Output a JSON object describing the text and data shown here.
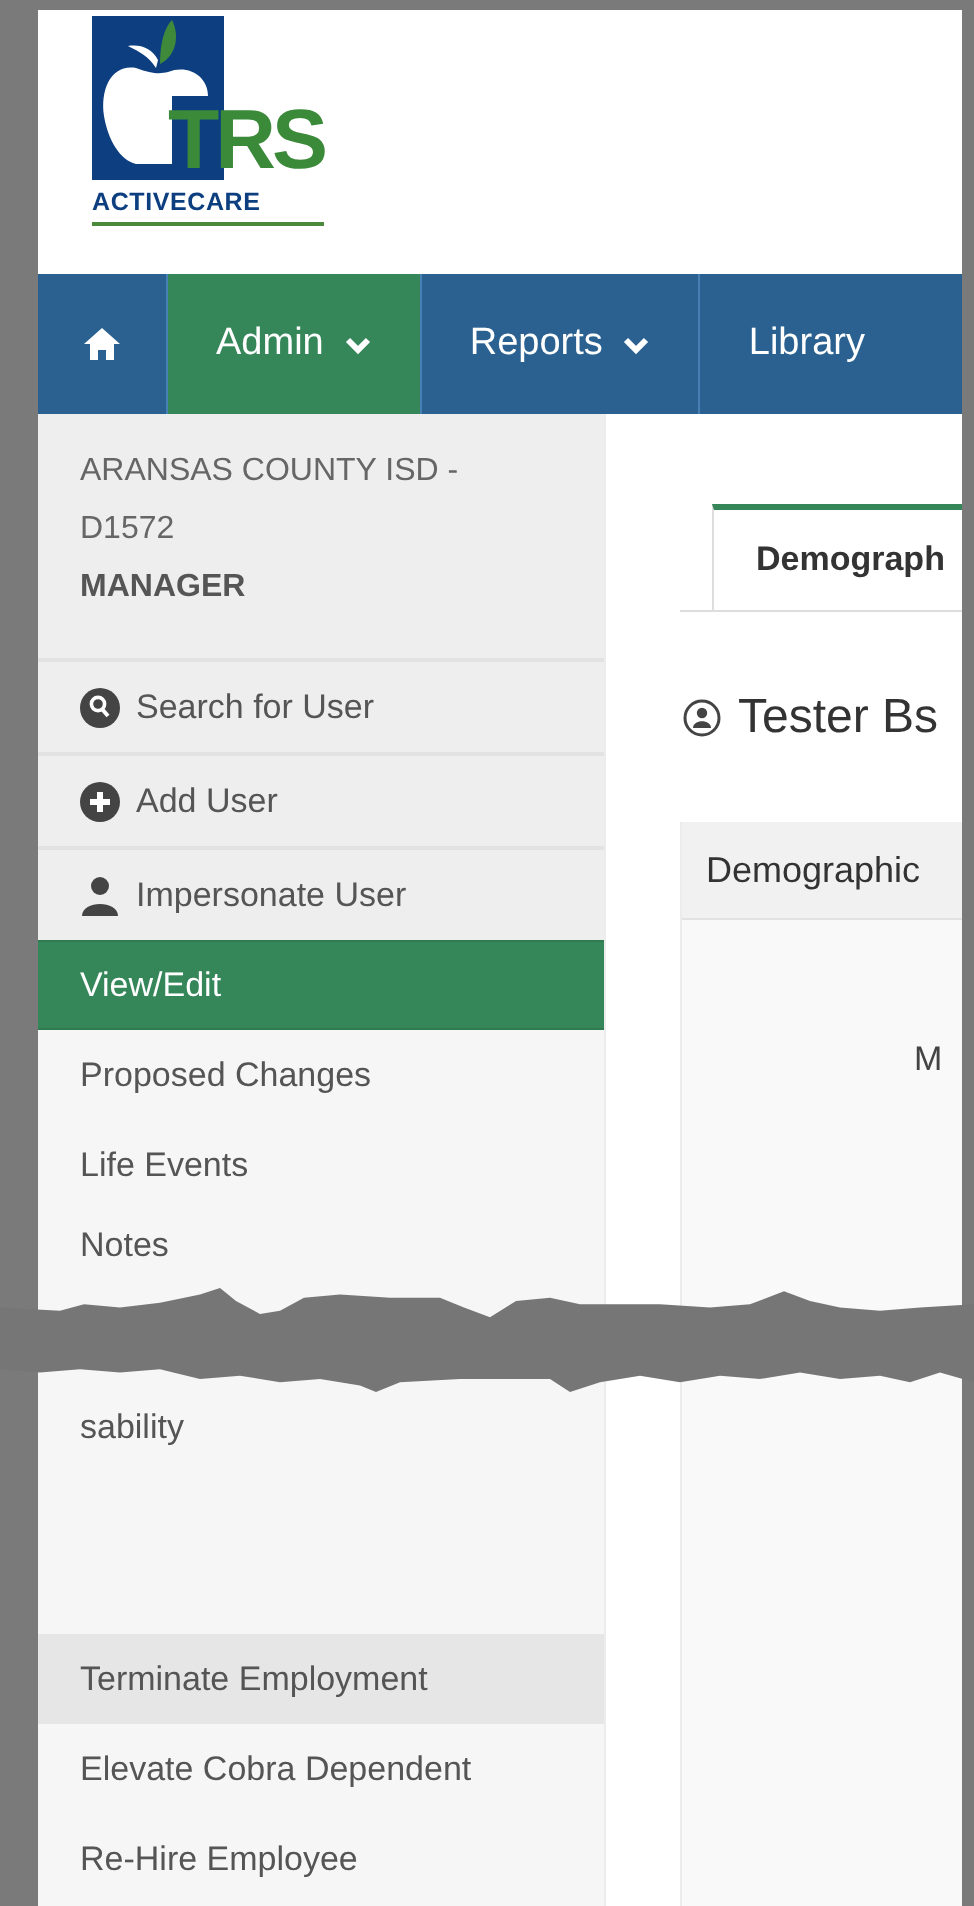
{
  "logo": {
    "title": "TRS",
    "subtitle": "ACTIVECARE"
  },
  "nav": [
    {
      "kind": "home",
      "selected": false
    },
    {
      "kind": "menu",
      "label": "Admin",
      "selected": true,
      "dropdown": true
    },
    {
      "kind": "menu",
      "label": "Reports",
      "selected": false,
      "dropdown": true
    },
    {
      "kind": "menu",
      "label": "Library",
      "selected": false,
      "dropdown": false
    }
  ],
  "sidebar": {
    "org": "ARANSAS COUNTY ISD - D1572",
    "role": "MANAGER",
    "items": [
      {
        "kind": "search",
        "label": "Search for User",
        "selected": false,
        "highlighted": false
      },
      {
        "kind": "add",
        "label": "Add User",
        "selected": false,
        "highlighted": false
      },
      {
        "kind": "impersonate",
        "label": "Impersonate User",
        "selected": false,
        "highlighted": false
      },
      {
        "kind": "link",
        "label": "View/Edit",
        "selected": true,
        "highlighted": false
      },
      {
        "kind": "link",
        "label": "Proposed Changes",
        "selected": false,
        "highlighted": false
      },
      {
        "kind": "link",
        "label": "Life Events",
        "selected": false,
        "highlighted": false
      },
      {
        "kind": "link",
        "label": "Notes",
        "selected": false,
        "highlighted": false,
        "gap_after": true
      },
      {
        "kind": "link",
        "label": "sability",
        "selected": false,
        "highlighted": false,
        "gap_after": true
      },
      {
        "kind": "link",
        "label": "Terminate Employment",
        "selected": false,
        "highlighted": true
      },
      {
        "kind": "link",
        "label": "Elevate Cobra Dependent",
        "selected": false,
        "highlighted": false
      },
      {
        "kind": "link",
        "label": "Re-Hire Employee",
        "selected": false,
        "highlighted": false
      }
    ]
  },
  "content": {
    "tabs": [
      {
        "label": "Demograph",
        "selected": true
      }
    ],
    "title": "Tester Bs",
    "panel": {
      "header": "Demographic",
      "text": "M"
    }
  }
}
